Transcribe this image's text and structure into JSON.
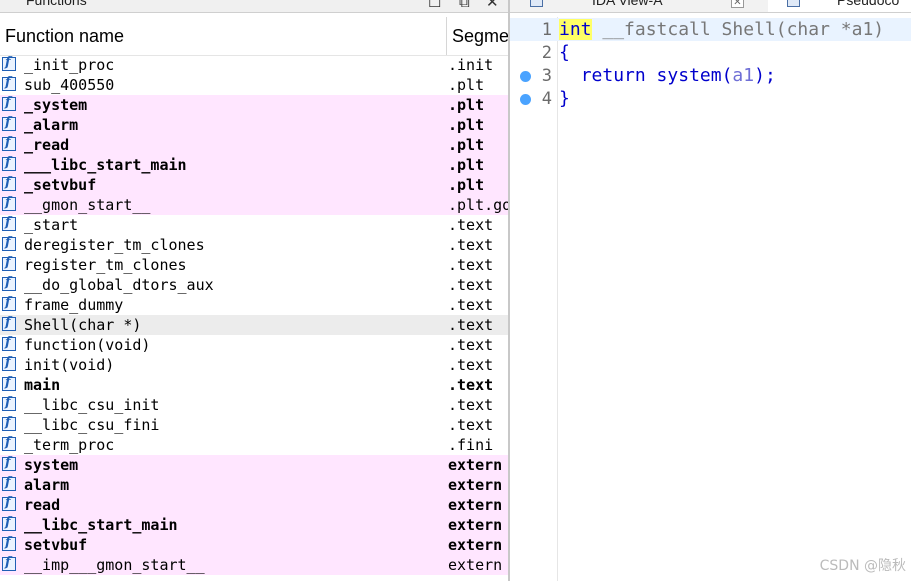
{
  "functions_window": {
    "title": "Functions",
    "minimize_glyph": "☐",
    "float_glyph": "⧉",
    "close_glyph": "✕",
    "columns": {
      "name": "Function name",
      "segment": "Segme"
    },
    "rows": [
      {
        "name": "_init_proc",
        "segment": ".init",
        "style": "normal"
      },
      {
        "name": "sub_400550",
        "segment": ".plt",
        "style": "normal"
      },
      {
        "name": "_system",
        "segment": ".plt",
        "style": "pink-bold"
      },
      {
        "name": "_alarm",
        "segment": ".plt",
        "style": "pink-bold"
      },
      {
        "name": "_read",
        "segment": ".plt",
        "style": "pink-bold"
      },
      {
        "name": "___libc_start_main",
        "segment": ".plt",
        "style": "pink-bold"
      },
      {
        "name": "_setvbuf",
        "segment": ".plt",
        "style": "pink-bold"
      },
      {
        "name": "__gmon_start__",
        "segment": ".plt.go",
        "style": "pink"
      },
      {
        "name": "_start",
        "segment": ".text",
        "style": "normal"
      },
      {
        "name": "deregister_tm_clones",
        "segment": ".text",
        "style": "normal"
      },
      {
        "name": "register_tm_clones",
        "segment": ".text",
        "style": "normal"
      },
      {
        "name": "__do_global_dtors_aux",
        "segment": ".text",
        "style": "normal"
      },
      {
        "name": "frame_dummy",
        "segment": ".text",
        "style": "normal"
      },
      {
        "name": "Shell(char *)",
        "segment": ".text",
        "style": "selected"
      },
      {
        "name": "function(void)",
        "segment": ".text",
        "style": "normal"
      },
      {
        "name": "init(void)",
        "segment": ".text",
        "style": "normal"
      },
      {
        "name": "main",
        "segment": ".text",
        "style": "bold"
      },
      {
        "name": "__libc_csu_init",
        "segment": ".text",
        "style": "normal"
      },
      {
        "name": "__libc_csu_fini",
        "segment": ".text",
        "style": "normal"
      },
      {
        "name": "_term_proc",
        "segment": ".fini",
        "style": "normal"
      },
      {
        "name": "system",
        "segment": "extern",
        "style": "pink-bold"
      },
      {
        "name": "alarm",
        "segment": "extern",
        "style": "pink-bold"
      },
      {
        "name": "read",
        "segment": "extern",
        "style": "pink-bold"
      },
      {
        "name": "__libc_start_main",
        "segment": "extern",
        "style": "pink-bold"
      },
      {
        "name": "setvbuf",
        "segment": "extern",
        "style": "pink-bold"
      },
      {
        "name": "__imp___gmon_start__",
        "segment": "extern",
        "style": "pink"
      }
    ]
  },
  "tabs": {
    "ida_view": "IDA View-A",
    "ida_view_close": "✕",
    "pseudocode": "Pseudoco"
  },
  "code": {
    "lines": [
      {
        "num": "1",
        "breakpoint": false
      },
      {
        "num": "2",
        "breakpoint": false
      },
      {
        "num": "3",
        "breakpoint": true
      },
      {
        "num": "4",
        "breakpoint": true
      }
    ],
    "line1": {
      "kw_int": "int",
      "rest": " __fastcall Shell(char *",
      "arg": "a1",
      "close": ")"
    },
    "line2": "{",
    "line3": {
      "indent": "  ",
      "kw_return": "return",
      "call": " system(",
      "arg": "a1",
      "end": ");"
    },
    "line4": "}"
  },
  "watermark": "CSDN @隐秋",
  "colors": {
    "pink_row": "#ffe6ff",
    "selected_row": "#ececec",
    "keyword": "#0000cc",
    "int_highlight": "#ffff66",
    "variable": "#6f6fd6",
    "breakpoint": "#4aa3ff"
  }
}
